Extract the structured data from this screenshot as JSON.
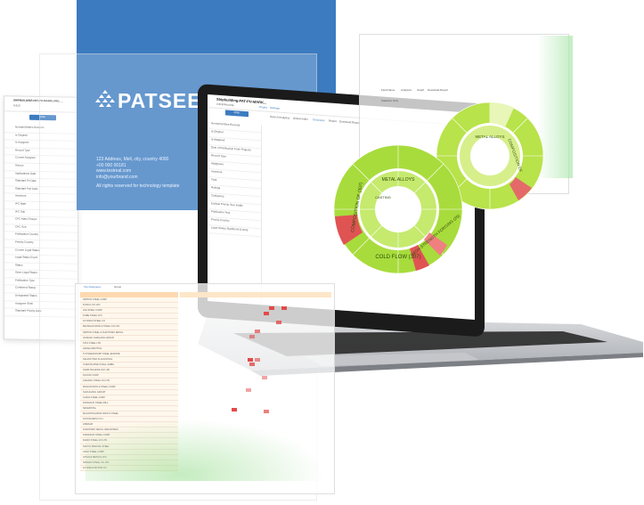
{
  "brand": {
    "name": "PATSEER",
    "contact": {
      "address": "123 Address, Mell, city, country 4000",
      "phone": "+00 000 00181",
      "website": "www.testreal.com",
      "email": "info@yourbrand.com"
    },
    "rights": "All rights reserved for technology template"
  },
  "left_panel": {
    "title": "SHIPBUILDING-PAT-PU-MARKLAND, ...",
    "count": "0 818",
    "filter_button": "Filter",
    "items": [
      "Normal Entities Records",
      "Is Original",
      "Is Assigned",
      "Record Type",
      "Current Assignee",
      "Source",
      "Applications Date",
      "Standard Pri Date",
      "Standard Pub Date",
      "Inventors",
      "IPC Main",
      "IPC Sub",
      "CPC Main Groups",
      "CPC Sub",
      "Publication Country",
      "Priority Country",
      "Current Legal Status",
      "Legal Status Event",
      "Status",
      "Open Legal Status",
      "Publication Type",
      "Combined Status",
      "Designated States",
      "Assignee Shell",
      "Standard Priority Date"
    ]
  },
  "laptop": {
    "tab_title": "Shipbuilding-PAT-PU-MARK...",
    "record_count": "0 818 Records",
    "toolbar": [
      "Charts",
      "Settings"
    ],
    "menu": [
      "Search Analytics",
      "Global Index",
      "Structures",
      "Report",
      "Download Report"
    ],
    "filter_button": "Filter",
    "sidebar_items": [
      "Normal Entities Records",
      "Is Original",
      "Is Assigned",
      "Date of Publication From Projects",
      "Record Type",
      "Assignees",
      "Inventors",
      "Tags",
      "Ratings",
      "Categories",
      "Earliest Priority Year Inside",
      "Publication Year",
      "Priority Country",
      "Legal Status Significant Events"
    ],
    "sunburst": {
      "inner_labels": [
        "METAL ALLOYS",
        "COMPOSITION OF",
        "CASTING"
      ],
      "outer_labels": [
        "COLD FLOW (307)",
        "COMPOSITION OF (307)",
        "HIGH-STRENGTH FORGING (25)"
      ]
    }
  },
  "right_panel": {
    "tabs": [
      "Field Name",
      "Analytics",
      "Graph",
      "Download Report"
    ],
    "sub": "Statistics Only"
  },
  "front_panel": {
    "header": "Top Assignees",
    "filter": "Group",
    "rows": [
      "NIPPON STEEL CORP",
      "POSCO CO LTD",
      "JFE STEEL CORP",
      "KOBE STEEL LTD",
      "HYUNDAI STEEL CO",
      "BAOSHAN IRON & STEEL CO LTD",
      "NIPPON STEEL & SUMITOMO METAL",
      "JIANGSU SHAGANG GROUP",
      "TATA STEEL LTD",
      "ARCELORMITTAL",
      "THYSSENKRUPP STEEL EUROPE",
      "SALZGITTER FLACHSTAHL",
      "VOESTALPINE STAHL GMBH",
      "SSAB TECHNOLOGY AB",
      "NUCOR CORP",
      "ANGANG STEEL CO LTD",
      "WUHAN IRON & STEEL CORP",
      "SHOUGANG GROUP",
      "CHINA STEEL CORP",
      "DONGKUK STEEL MILL",
      "SEVERSTAL",
      "MAGNITOGORSK IRON & STEEL",
      "OUTOKUMPU OYJ",
      "APERAM",
      "SUMITOMO METAL INDUSTRIES",
      "KAWASAKI STEEL CORP",
      "DAIDO STEEL CO LTD",
      "SANYO SPECIAL STEEL",
      "AICHI STEEL CORP",
      "HITACHI METALS LTD",
      "NISSHIN STEEL CO LTD",
      "HYUNDAI MOTOR CO"
    ]
  },
  "colors": {
    "brand_blue": "#3c7bc0",
    "sunburst_green": "#a8dc3c",
    "heat_red": "#e34a4a",
    "table_header": "#fdd9b0"
  }
}
